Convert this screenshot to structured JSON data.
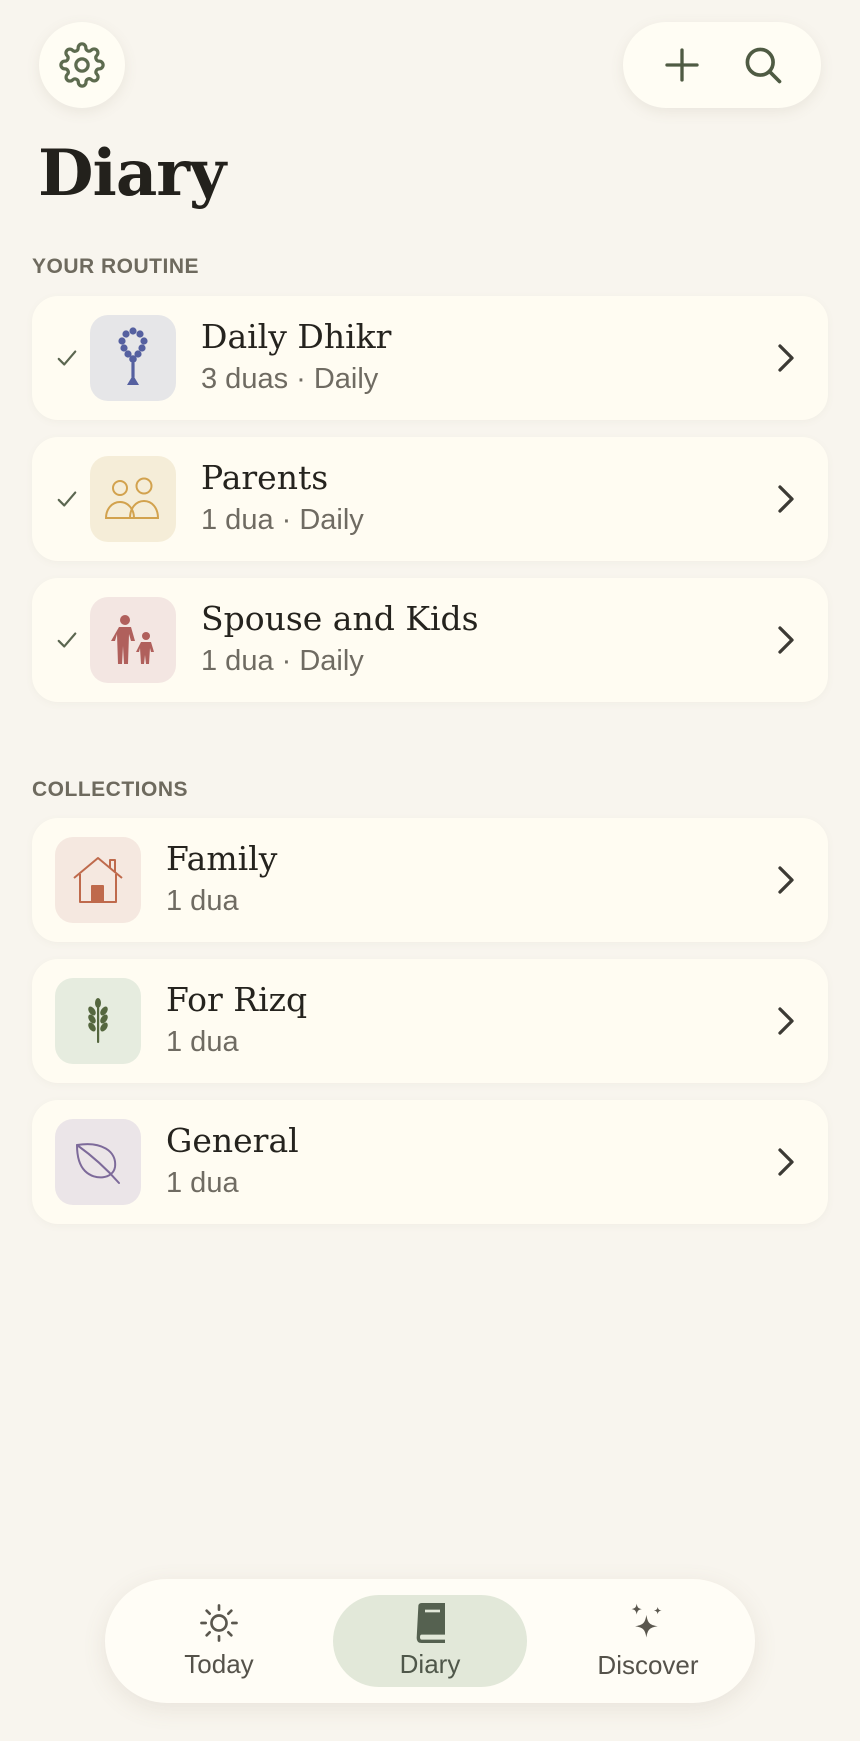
{
  "page": {
    "title": "Diary"
  },
  "colors": {
    "background": "#f8f5ee",
    "accent_green": "#5d6b4f",
    "card": "#fffcf2"
  },
  "header": {
    "settings_icon": "gear-icon",
    "add_icon": "plus-icon",
    "search_icon": "search-icon"
  },
  "routine": {
    "label": "YOUR ROUTINE",
    "items": [
      {
        "title": "Daily Dhikr",
        "subtitle": "3 duas · Daily",
        "icon": "prayer-beads-icon",
        "tile_color": "#e6e6e8"
      },
      {
        "title": "Parents",
        "subtitle": "1 dua · Daily",
        "icon": "people-icon",
        "tile_color": "#f5edd8"
      },
      {
        "title": "Spouse and Kids",
        "subtitle": "1 dua · Daily",
        "icon": "parent-child-icon",
        "tile_color": "#f3e6e2"
      }
    ]
  },
  "collections": {
    "label": "COLLECTIONS",
    "items": [
      {
        "title": "Family",
        "subtitle": "1 dua",
        "icon": "house-icon",
        "tile_color": "#f5e8e0"
      },
      {
        "title": "For Rizq",
        "subtitle": "1 dua",
        "icon": "wheat-icon",
        "tile_color": "#e6ecdf"
      },
      {
        "title": "General",
        "subtitle": "1 dua",
        "icon": "leaf-icon",
        "tile_color": "#ebe5e8"
      }
    ]
  },
  "nav": {
    "items": [
      {
        "label": "Today",
        "icon": "sun-icon"
      },
      {
        "label": "Diary",
        "icon": "book-icon",
        "active": true
      },
      {
        "label": "Discover",
        "icon": "sparkle-icon"
      }
    ]
  }
}
